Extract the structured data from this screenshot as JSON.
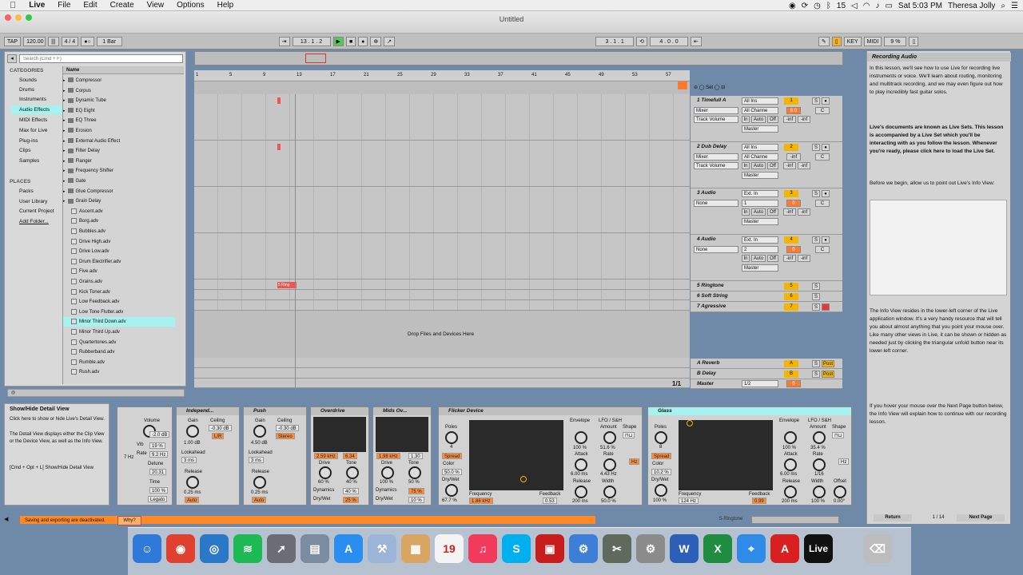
{
  "menubar": {
    "app_name": "Live",
    "menus": [
      "File",
      "Edit",
      "Create",
      "View",
      "Options",
      "Help"
    ],
    "status_num": "15",
    "clock": "Sat 5:03 PM",
    "user": "Theresa Jolly"
  },
  "window": {
    "title": "Untitled"
  },
  "control_bar": {
    "tap": "TAP",
    "tempo": "120.00",
    "time_sig": "4 / 4",
    "quantize": "1 Bar",
    "position": "13 . 1 . 2",
    "loop_start": "3 . 1 . 1",
    "loop_length": "4 . 0 . 0",
    "key": "KEY",
    "midi": "MIDI",
    "cpu": "9 %"
  },
  "browser": {
    "search_placeholder": "Search (Cmd + F)",
    "categories_header": "CATEGORIES",
    "categories": [
      "Sounds",
      "Drums",
      "Instruments",
      "Audio Effects",
      "MIDI Effects",
      "Max for Live",
      "Plug-ins",
      "Clips",
      "Samples"
    ],
    "places_header": "PLACES",
    "places": [
      "Packs",
      "User Library",
      "Current Project",
      "Add Folder..."
    ],
    "column_name": "Name",
    "folders": [
      "Compressor",
      "Corpus",
      "Dynamic Tube",
      "EQ Eight",
      "EQ Three",
      "Erosion",
      "External Audio Effect",
      "Filter Delay",
      "Flanger",
      "Frequency Shifter",
      "Gate",
      "Glue Compressor",
      "Grain Delay"
    ],
    "files": [
      "Ascent.adv",
      "Borg.adv",
      "Bubbles.adv",
      "Drive High.adv",
      "Drive Low.adv",
      "Drum Electrifier.adv",
      "Five.adv",
      "Grains.adv",
      "Kick Toner.adv",
      "Low Feedback.adv",
      "Low Tone Flutter.adv",
      "Minor Third Down.adv",
      "Minor Third Up.adv",
      "Quartertones.adv",
      "Rubberband.adv",
      "Rumble.adv",
      "Rush.adv"
    ]
  },
  "ruler": {
    "bars": [
      "1",
      "5",
      "9",
      "13",
      "17",
      "21",
      "25",
      "29",
      "33",
      "37",
      "41",
      "45",
      "49",
      "53",
      "57"
    ]
  },
  "tracks": [
    {
      "name": "1 Timefull A",
      "input": "All Ins",
      "channel": "All Channe",
      "route": "Mixer",
      "vol": "Track Volume",
      "num": "1",
      "val": "6.0",
      "pan": "C"
    },
    {
      "name": "2 Dub Delay",
      "input": "All Ins",
      "channel": "All Channe",
      "route": "Mixer",
      "vol": "Track Volume",
      "num": "2",
      "val": "-inf",
      "pan": "C"
    },
    {
      "name": "3 Audio",
      "input": "Ext. In",
      "channel": "1",
      "route": "None",
      "num": "3",
      "val": "0",
      "pan": "C"
    },
    {
      "name": "4 Audio",
      "input": "Ext. In",
      "channel": "2",
      "route": "None",
      "num": "4",
      "val": "0",
      "pan": "C"
    },
    {
      "name": "5 Ringtone",
      "num": "5"
    },
    {
      "name": "6 Soft String",
      "num": "6"
    },
    {
      "name": "7 Agressive",
      "num": "7"
    }
  ],
  "track_labels": {
    "in": "In",
    "auto": "Auto",
    "off": "Off",
    "master": "Master",
    "inf": "-inf",
    "s": "S"
  },
  "returns": [
    {
      "name": "A Reverb",
      "letter": "A",
      "post": "Post"
    },
    {
      "name": "B Delay",
      "letter": "B",
      "post": "Post"
    },
    {
      "name": "Master",
      "route": "1/2",
      "val": "0"
    }
  ],
  "arrangement": {
    "drop_message": "Drop Files and Devices Here",
    "page": "1/1",
    "clip_label": "5 Ring"
  },
  "info_view": {
    "title": "Recording Audio",
    "p1": "In this lesson, we'll see how to use Live for recording live instruments or voice. We'll learn about routing, monitoring and multitrack recording, and we may even figure out how to play incredibly fast guitar solos.",
    "p2": "Live's documents are known as Live Sets. This lesson is accompanied by a Live Set which you'll be interacting with as you follow the lesson. Whenever you're ready, please click here to load the Live Set.",
    "p3": "Before we begin, allow us to point out Live's Info View:",
    "p4": "The Info View resides in the lower-left corner of the Live application window. It's a very handy resource that will tell you about almost anything that you point your mouse over. Like many other views in Live, it can be shown or hidden as needed just by clicking the triangular unfold button near its lower-left corner.",
    "p5": "If you hover your mouse over the Next Page button below, the Info View will explain how to continue with our recording lesson.",
    "return": "Return",
    "page": "1 / 14",
    "next": "Next Page"
  },
  "detail_info": {
    "title": "Show/Hide Detail View",
    "body": "Click here to show or hide Live's Detail View.",
    "body2": "The Detail View displays either the Clip View or the Device View, as well as the Info View.",
    "shortcut": "[Cmd + Opt + L] Show/Hide Detail View"
  },
  "devices": {
    "mixer": {
      "volume": "Volume",
      "vol_val": "-2.0 dB",
      "vib": "Vib",
      "vib_val": "19 %",
      "rate": "Rate",
      "rate_val": "9.2 Hz",
      "detune": "Detune",
      "detune_val": "20.31",
      "time": "Time",
      "time_val": "100 %",
      "legato": "Legato",
      "hz": "7 Hz"
    },
    "independent": {
      "name": "Independ...",
      "gain": "Gain",
      "gain_val": "1.00 dB",
      "ceiling": "Ceiling",
      "ceil_val": "-0.30 dB",
      "lookahead": "Lookahead",
      "look_val": "3 ms",
      "release": "Release",
      "rel_val": "0.25 ms",
      "auto": "Auto",
      "lr": "L/R"
    },
    "push": {
      "name": "Push",
      "gain": "Gain",
      "gain_val": "4.50 dB",
      "ceiling": "Ceiling",
      "ceil_val": "-0.30 dB",
      "lookahead": "Lookahead",
      "look_val": "3 ms",
      "release": "Release",
      "rel_val": "0.25 ms",
      "auto": "Auto",
      "stereo": "Stereo"
    },
    "overdrive": {
      "name": "Overdrive",
      "f1": "2.59 kHz",
      "f2": "6.34",
      "drive": "Drive",
      "drive_val": "60 %",
      "tone": "Tone",
      "tone_val": "40 %",
      "dynamics": "Dynamics",
      "dyn_val": "40 %",
      "drywet": "Dry/Wet",
      "dw_val": "25 %"
    },
    "midsov": {
      "name": "Mids Ov...",
      "f1": "1.98 kHz",
      "f2": "1.30",
      "drive": "Drive",
      "drive_val": "100 %",
      "tone": "Tone",
      "tone_val": "50 %",
      "dynamics": "Dynamics",
      "dyn_val": "75 %",
      "drywet": "Dry/Wet",
      "dw_val": "10 %"
    },
    "flicker": {
      "name": "Flicker Device",
      "poles": "Poles",
      "poles_val": "4",
      "spread": "Spread",
      "color": "Color",
      "color_val": "50.0 %",
      "drywet": "Dry/Wet",
      "dw_val": "67.7 %",
      "frequency": "Frequency",
      "freq_val": "1.86 kHz",
      "feedback": "Feedback",
      "fb_val": "0.53",
      "envelope": "Envelope",
      "env_val": "100 %",
      "attack": "Attack",
      "att_val": "6.00 ms",
      "release": "Release",
      "rel_val": "200 ms",
      "lfo": "LFO / S&H",
      "amount": "Amount",
      "amt_val": "51.6 %",
      "shape": "Shape",
      "rate": "Rate",
      "rate_val": "4.43 Hz",
      "width": "Width",
      "width_val": "50.0 %",
      "hz": "Hz"
    },
    "glass": {
      "name": "Glass",
      "poles": "Poles",
      "poles_val": "8",
      "spread": "Spread",
      "color": "Color",
      "color_val": "10.2 %",
      "drywet": "Dry/Wet",
      "dw_val": "100 %",
      "frequency": "Frequency",
      "freq_val": "124 Hz",
      "feedback": "Feedback",
      "fb_val": "0.99",
      "envelope": "Envelope",
      "env_val": "100 %",
      "attack": "Attack",
      "att_val": "6.00 ms",
      "release": "Release",
      "rel_val": "200 ms",
      "lfo": "LFO / S&H",
      "amount": "Amount",
      "amt_val": "35.4 %",
      "shape": "Shape",
      "rate": "Rate",
      "rate_val": "1/16",
      "width": "Width",
      "width_val": "100 %",
      "offset": "Offset",
      "off_val": "0.00°",
      "hz": "Hz"
    }
  },
  "status": {
    "message": "Saving and exporting are deactivated.",
    "why": "Why?",
    "track": "5-Ringtone"
  },
  "dock": {
    "calendar_day": "19",
    "live_label": "Live"
  }
}
